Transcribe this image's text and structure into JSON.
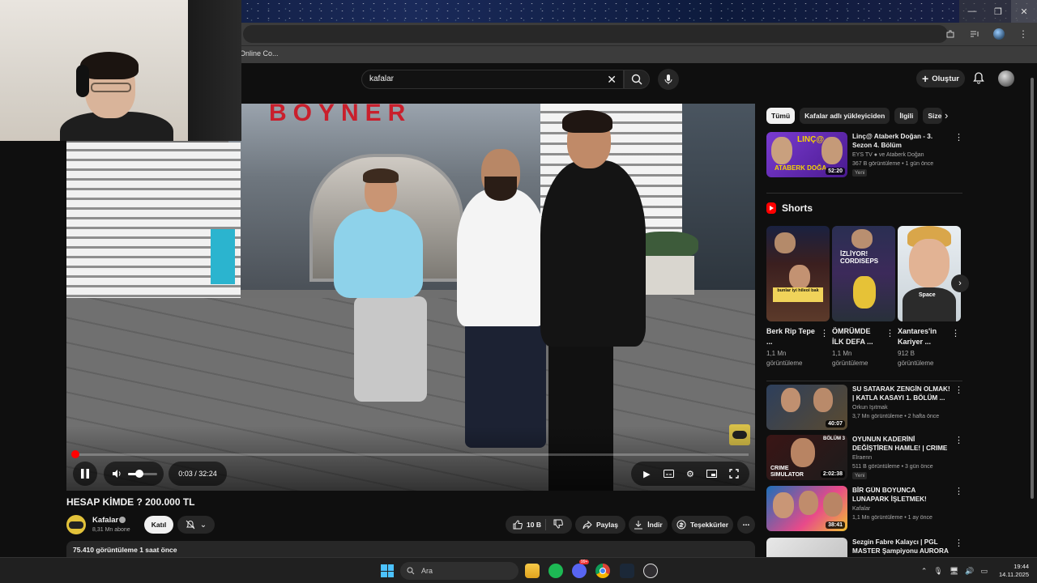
{
  "browser": {
    "bookmark_label": "Online Co...",
    "window_controls": {
      "minimize": "—",
      "maximize": "❐",
      "close": "✕"
    }
  },
  "header": {
    "search_query": "kafalar",
    "create_label": "Oluştur",
    "icons": [
      "search-icon",
      "mic-icon",
      "bell-icon",
      "avatar"
    ]
  },
  "player": {
    "current_time": "0:03",
    "duration": "32:24",
    "progress": 0.0015,
    "volume": 0.4,
    "time_label": "0:03 / 32:24",
    "sign_text": "BOYNER",
    "colors": {
      "progress": "#ff0000",
      "accent": "#c91f2c"
    }
  },
  "video": {
    "title": "HESAP KİMDE ? 200.000 TL",
    "channel": "Kafalar",
    "subscribers": "8,31 Mn abone",
    "join_label": "Katıl",
    "like_count": "10 B",
    "share_label": "Paylaş",
    "download_label": "İndir",
    "thanks_label": "Teşekkürler",
    "views_and_time": "75.410 görüntüleme  1 saat önce"
  },
  "sidebar": {
    "chips": [
      "Tümü",
      "Kafalar adlı yükleyiciden",
      "İlgili",
      "Size"
    ],
    "first": {
      "title": "Linç@ Ataberk Doğan - 3. Sezon 4. Bölüm",
      "channel": "EYS TV ● ve Ataberk Doğan",
      "meta": "367 B görüntüleme • 1 gün önce",
      "badge": "Yeni",
      "duration": "52:20"
    },
    "shorts_title": "Shorts",
    "shorts": [
      {
        "title": "Berk Rip Tepe ...",
        "views": "1,1 Mn görüntüleme",
        "overlay": "bunlar iyi hileol bak"
      },
      {
        "title": "ÖMRÜMDE İLK DEFA ...",
        "views": "1,1 Mn görüntüleme",
        "overlay": "İZLİYOR! CORDISEPS"
      },
      {
        "title": "Xantares'in Kariyer ...",
        "views": "912 B görüntüleme",
        "overlay": "Space"
      }
    ],
    "videos": [
      {
        "title": "SU SATARAK ZENGİN OLMAK! | KATLA KASAYI 1. BÖLÜM ...",
        "channel": "Orkun Işıtmak",
        "meta": "3,7 Mn görüntüleme • 2 hafta önce",
        "duration": "40:07",
        "badge": ""
      },
      {
        "title": "OYUNUN KADERİNİ DEĞİŞTİREN HAMLE! | CRIME ...",
        "channel": "Elraenn",
        "meta": "511 B görüntüleme • 3 gün önce",
        "duration": "2:02:38",
        "badge": "Yeni",
        "thumb_text": "CRIME SIMULATOR",
        "thumb_tag": "BÖLÜM 3"
      },
      {
        "title": "BİR GÜN BOYUNCA LUNAPARK İŞLETMEK!",
        "channel": "Kafalar",
        "meta": "1,1 Mn görüntüleme • 1 ay önce",
        "duration": "38:41",
        "badge": ""
      },
      {
        "title": "Sezgin Fabre Kalaycı | PGL MASTER Şampiyonu AURORA ...",
        "channel": "",
        "meta": "",
        "duration": "",
        "badge": ""
      }
    ]
  },
  "taskbar": {
    "search_placeholder": "Ara",
    "time": "19:44",
    "date": "14.11.2025",
    "discord_badge": "99+"
  }
}
